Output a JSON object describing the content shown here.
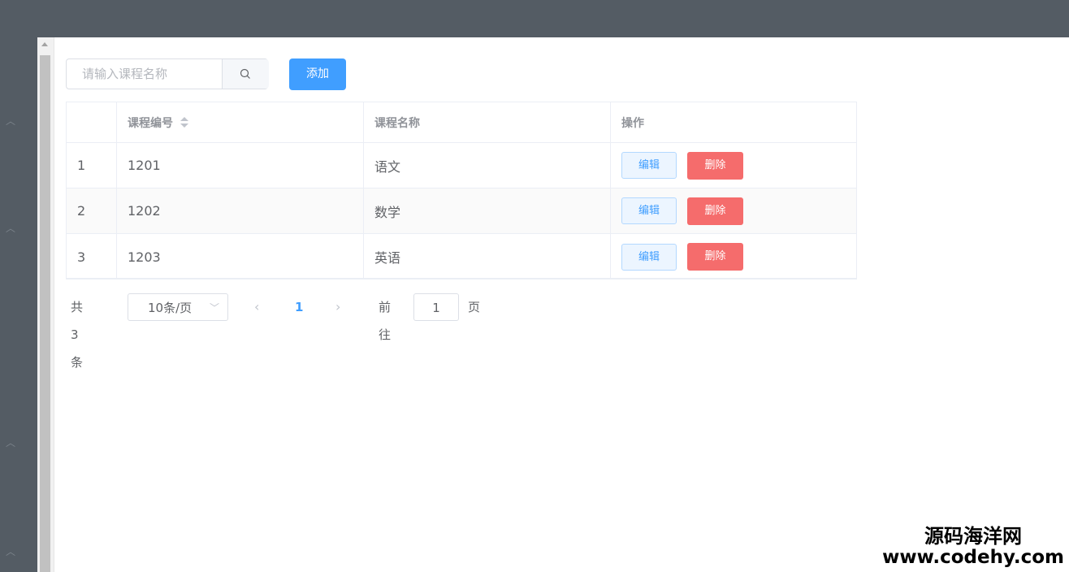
{
  "search": {
    "placeholder": "请输入课程名称"
  },
  "toolbar": {
    "add_label": "添加"
  },
  "table": {
    "columns": [
      "",
      "课程编号",
      "课程名称",
      "操作"
    ],
    "rows": [
      {
        "index": "1",
        "code": "1201",
        "name": "语文",
        "edit": "编辑",
        "delete": "删除"
      },
      {
        "index": "2",
        "code": "1202",
        "name": "数学",
        "edit": "编辑",
        "delete": "删除"
      },
      {
        "index": "3",
        "code": "1203",
        "name": "英语",
        "edit": "编辑",
        "delete": "删除"
      }
    ]
  },
  "pagination": {
    "total_text": "共 3 条",
    "page_size": "10条/页",
    "current_page": "1",
    "goto_label": "前往",
    "goto_value": "1",
    "page_suffix": "页"
  },
  "watermark": {
    "name": "源码海洋网",
    "url": "www.codehy.com"
  },
  "colors": {
    "primary": "#409eff",
    "danger": "#f56c6c",
    "sidebar": "#545c64"
  }
}
